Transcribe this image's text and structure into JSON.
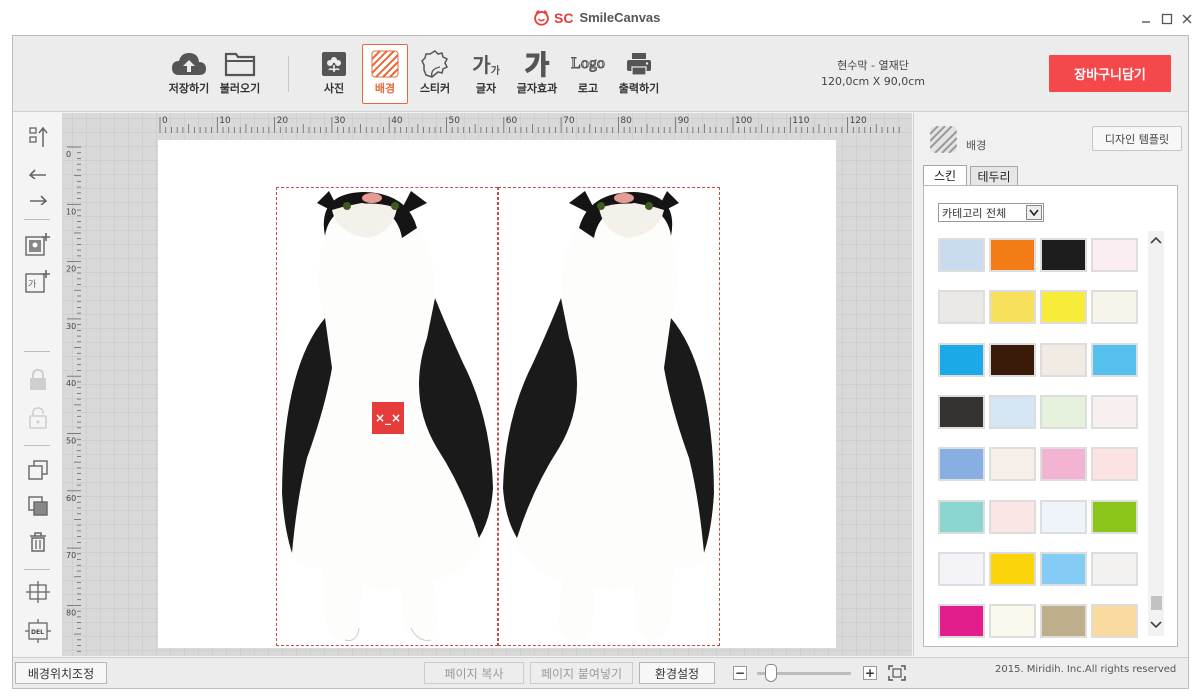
{
  "titlebar": {
    "brand_short": "SC",
    "brand_name": "SmileCanvas"
  },
  "toolbar": {
    "save_label": "저장하기",
    "load_label": "불러오기",
    "photo_label": "사진",
    "background_label": "배경",
    "sticker_label": "스티커",
    "text_label": "글자",
    "text_glyph": "가",
    "text_glyph_sub": "가",
    "texteffect_label": "글자효과",
    "texteffect_glyph": "가",
    "logo_label": "로고",
    "logo_glyph": "Logo",
    "print_label": "출력하기",
    "active_tool": "background"
  },
  "product": {
    "name": "현수막 - 열재단",
    "size": "120,0cm X 90,0cm"
  },
  "cart_button": "장바구니담기",
  "ruler": {
    "top_labels": [
      "0",
      "10",
      "20",
      "30",
      "40",
      "50",
      "60",
      "70",
      "80",
      "90",
      "100",
      "110",
      "120"
    ],
    "left_labels": [
      "0",
      "10",
      "20",
      "30",
      "40",
      "50",
      "60",
      "70",
      "80"
    ]
  },
  "canvas": {
    "error_badge": "×_×"
  },
  "right_panel": {
    "title": "배경",
    "template_button": "디자인 템플릿",
    "tabs": [
      "스킨",
      "테두리"
    ],
    "active_tab": "스킨",
    "category_select": "카테고리 전체",
    "swatches": [
      [
        "#c9dbee",
        "#f47c16",
        "#1e1d1e",
        "#fbeef2"
      ],
      [
        "#ebe8e6",
        "#f7e15c",
        "#f6ec39",
        "#f7f4ec"
      ],
      [
        "#1ba9e7",
        "#3a1a08",
        "#f1ebe4",
        "#55bfee"
      ],
      [
        "#353232",
        "#d7e6f4",
        "#e6f2dd",
        "#f8f0ef"
      ],
      [
        "#88aee3",
        "#f5efe8",
        "#f3b4d3",
        "#fbe3e3"
      ],
      [
        "#8cd6d0",
        "#fbe6e6",
        "#eef4f9",
        "#8bc41a"
      ],
      [
        "#f4f4f8",
        "#fbd40a",
        "#84ccf5",
        "#f4f2f0"
      ],
      [
        "#e31e8c",
        "#fbf8ed",
        "#bfae8c",
        "#f9dba0"
      ]
    ]
  },
  "bottombar": {
    "bg_position_button": "배경위치조정",
    "page_copy": "페이지 복사",
    "page_paste": "페이지 붙여넣기",
    "settings": "환경설정",
    "zoom_level": 0.15
  },
  "copyright": "2015. Miridih. Inc.All rights reserved"
}
